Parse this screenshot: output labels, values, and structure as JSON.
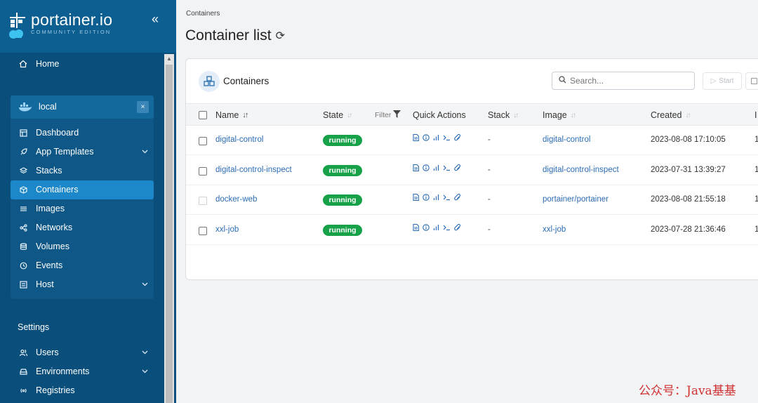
{
  "brand": {
    "name": "portainer.io",
    "edition": "COMMUNITY EDITION"
  },
  "sidebar": {
    "home": "Home",
    "environment": {
      "name": "local",
      "close": "×"
    },
    "env_items": [
      {
        "label": "Dashboard",
        "icon": "dashboard-icon"
      },
      {
        "label": "App Templates",
        "icon": "rocket-icon",
        "expandable": true
      },
      {
        "label": "Stacks",
        "icon": "layers-icon"
      },
      {
        "label": "Containers",
        "icon": "box-icon",
        "active": true
      },
      {
        "label": "Images",
        "icon": "list-icon"
      },
      {
        "label": "Networks",
        "icon": "share-icon"
      },
      {
        "label": "Volumes",
        "icon": "database-icon"
      },
      {
        "label": "Events",
        "icon": "clock-icon"
      },
      {
        "label": "Host",
        "icon": "server-icon",
        "expandable": true
      }
    ],
    "settings_title": "Settings",
    "settings_items": [
      {
        "label": "Users",
        "icon": "users-icon",
        "expandable": true
      },
      {
        "label": "Environments",
        "icon": "hdd-icon",
        "expandable": true
      },
      {
        "label": "Registries",
        "icon": "radio-icon"
      }
    ]
  },
  "breadcrumb": "Containers",
  "page_title": "Container list",
  "card": {
    "title": "Containers",
    "search_placeholder": "Search...",
    "start_label": "Start"
  },
  "table": {
    "headers": {
      "name": "Name",
      "state": "State",
      "filter": "Filter",
      "quick_actions": "Quick Actions",
      "stack": "Stack",
      "image": "Image",
      "created": "Created",
      "ip": "I"
    },
    "rows": [
      {
        "name": "digital-control",
        "state": "running",
        "stack": "-",
        "image": "digital-control",
        "created": "2023-08-08 17:10:05",
        "ip": "1",
        "disabled": false
      },
      {
        "name": "digital-control-inspect",
        "state": "running",
        "stack": "-",
        "image": "digital-control-inspect",
        "created": "2023-07-31 13:39:27",
        "ip": "1",
        "disabled": false
      },
      {
        "name": "docker-web",
        "state": "running",
        "stack": "-",
        "image": "portainer/portainer",
        "created": "2023-08-08 21:55:18",
        "ip": "1",
        "disabled": true
      },
      {
        "name": "xxl-job",
        "state": "running",
        "stack": "-",
        "image": "xxl-job",
        "created": "2023-07-28 21:36:46",
        "ip": "1",
        "disabled": false
      }
    ]
  },
  "watermark": "公众号：Java基基",
  "colors": {
    "sidebar": "#0d5f91",
    "active": "#1c87c9",
    "running": "#17a24a",
    "link": "#2b6cb3"
  }
}
